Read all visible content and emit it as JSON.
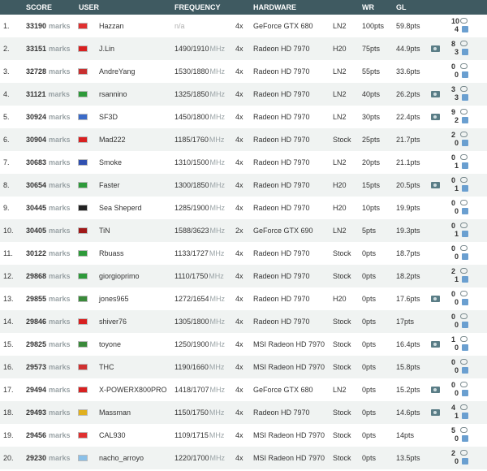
{
  "headers": {
    "score": "SCORE",
    "user": "USER",
    "frequency": "FREQUENCY",
    "hardware": "HARDWARE",
    "wr": "WR",
    "gl": "GL"
  },
  "rows": [
    {
      "rank": "1.",
      "score": "33190",
      "unit": "marks",
      "flag": "#e03030",
      "user": "Hazzan",
      "freq": "n/a",
      "mhz": "",
      "cores": "4x",
      "hw": "GeForce GTX 680",
      "cool": "LN2",
      "wr": "100pts",
      "gl": "59.8pts",
      "cam": false,
      "c1": "10",
      "c2": "4"
    },
    {
      "rank": "2.",
      "score": "33151",
      "unit": "marks",
      "flag": "#d82020",
      "user": "J.Lin",
      "freq": "1490/1910",
      "mhz": "MHz",
      "cores": "4x",
      "hw": "Radeon HD 7970",
      "cool": "H20",
      "wr": "75pts",
      "gl": "44.9pts",
      "cam": true,
      "c1": "8",
      "c2": "3"
    },
    {
      "rank": "3.",
      "score": "32728",
      "unit": "marks",
      "flag": "#c83030",
      "user": "AndreYang",
      "freq": "1530/1880",
      "mhz": "MHz",
      "cores": "4x",
      "hw": "Radeon HD 7970",
      "cool": "LN2",
      "wr": "55pts",
      "gl": "33.6pts",
      "cam": false,
      "c1": "0",
      "c2": "0"
    },
    {
      "rank": "4.",
      "score": "31121",
      "unit": "marks",
      "flag": "#2e9a3a",
      "user": "rsannino",
      "freq": "1325/1850",
      "mhz": "MHz",
      "cores": "4x",
      "hw": "Radeon HD 7970",
      "cool": "LN2",
      "wr": "40pts",
      "gl": "26.2pts",
      "cam": true,
      "c1": "3",
      "c2": "3"
    },
    {
      "rank": "5.",
      "score": "30924",
      "unit": "marks",
      "flag": "#3a6ac8",
      "user": "SF3D",
      "freq": "1450/1800",
      "mhz": "MHz",
      "cores": "4x",
      "hw": "Radeon HD 7970",
      "cool": "LN2",
      "wr": "30pts",
      "gl": "22.4pts",
      "cam": true,
      "c1": "9",
      "c2": "2"
    },
    {
      "rank": "6.",
      "score": "30904",
      "unit": "marks",
      "flag": "#d82020",
      "user": "Mad222",
      "freq": "1185/1760",
      "mhz": "MHz",
      "cores": "4x",
      "hw": "Radeon HD 7970",
      "cool": "Stock",
      "wr": "25pts",
      "gl": "21.7pts",
      "cam": false,
      "c1": "2",
      "c2": "0"
    },
    {
      "rank": "7.",
      "score": "30683",
      "unit": "marks",
      "flag": "#3050b0",
      "user": "Smoke",
      "freq": "1310/1500",
      "mhz": "MHz",
      "cores": "4x",
      "hw": "Radeon HD 7970",
      "cool": "LN2",
      "wr": "20pts",
      "gl": "21.1pts",
      "cam": false,
      "c1": "0",
      "c2": "1"
    },
    {
      "rank": "8.",
      "score": "30654",
      "unit": "marks",
      "flag": "#2e9a3a",
      "user": "Faster",
      "freq": "1300/1850",
      "mhz": "MHz",
      "cores": "4x",
      "hw": "Radeon HD 7970",
      "cool": "H20",
      "wr": "15pts",
      "gl": "20.5pts",
      "cam": true,
      "c1": "0",
      "c2": "1"
    },
    {
      "rank": "9.",
      "score": "30445",
      "unit": "marks",
      "flag": "#222222",
      "user": "Sea Sheperd",
      "freq": "1285/1900",
      "mhz": "MHz",
      "cores": "4x",
      "hw": "Radeon HD 7970",
      "cool": "H20",
      "wr": "10pts",
      "gl": "19.9pts",
      "cam": false,
      "c1": "0",
      "c2": "0"
    },
    {
      "rank": "10.",
      "score": "30405",
      "unit": "marks",
      "flag": "#a01818",
      "user": "TiN",
      "freq": "1588/3623",
      "mhz": "MHz",
      "cores": "2x",
      "hw": "GeForce GTX 690",
      "cool": "LN2",
      "wr": "5pts",
      "gl": "19.3pts",
      "cam": false,
      "c1": "0",
      "c2": "1"
    },
    {
      "rank": "11.",
      "score": "30122",
      "unit": "marks",
      "flag": "#2e9a3a",
      "user": "Rbuass",
      "freq": "1133/1727",
      "mhz": "MHz",
      "cores": "4x",
      "hw": "Radeon HD 7970",
      "cool": "Stock",
      "wr": "0pts",
      "gl": "18.7pts",
      "cam": false,
      "c1": "0",
      "c2": "0"
    },
    {
      "rank": "12.",
      "score": "29868",
      "unit": "marks",
      "flag": "#2e9a3a",
      "user": "giorgioprimo",
      "freq": "1110/1750",
      "mhz": "MHz",
      "cores": "4x",
      "hw": "Radeon HD 7970",
      "cool": "Stock",
      "wr": "0pts",
      "gl": "18.2pts",
      "cam": false,
      "c1": "2",
      "c2": "1"
    },
    {
      "rank": "13.",
      "score": "29855",
      "unit": "marks",
      "flag": "#3a8a3a",
      "user": "jones965",
      "freq": "1272/1654",
      "mhz": "MHz",
      "cores": "4x",
      "hw": "Radeon HD 7970",
      "cool": "H20",
      "wr": "0pts",
      "gl": "17.6pts",
      "cam": true,
      "c1": "0",
      "c2": "0"
    },
    {
      "rank": "14.",
      "score": "29846",
      "unit": "marks",
      "flag": "#d82020",
      "user": "shiver76",
      "freq": "1305/1800",
      "mhz": "MHz",
      "cores": "4x",
      "hw": "Radeon HD 7970",
      "cool": "Stock",
      "wr": "0pts",
      "gl": "17pts",
      "cam": false,
      "c1": "0",
      "c2": "0"
    },
    {
      "rank": "15.",
      "score": "29825",
      "unit": "marks",
      "flag": "#3a8a3a",
      "user": "toyone",
      "freq": "1250/1900",
      "mhz": "MHz",
      "cores": "4x",
      "hw": "MSI Radeon HD 7970",
      "cool": "Stock",
      "wr": "0pts",
      "gl": "16.4pts",
      "cam": true,
      "c1": "1",
      "c2": "0"
    },
    {
      "rank": "16.",
      "score": "29573",
      "unit": "marks",
      "flag": "#d03030",
      "user": "THC",
      "freq": "1190/1660",
      "mhz": "MHz",
      "cores": "4x",
      "hw": "MSI Radeon HD 7970",
      "cool": "Stock",
      "wr": "0pts",
      "gl": "15.8pts",
      "cam": false,
      "c1": "0",
      "c2": "0"
    },
    {
      "rank": "17.",
      "score": "29494",
      "unit": "marks",
      "flag": "#d82020",
      "user": "X-POWERX800PRO",
      "freq": "1418/1707",
      "mhz": "MHz",
      "cores": "4x",
      "hw": "GeForce GTX 680",
      "cool": "LN2",
      "wr": "0pts",
      "gl": "15.2pts",
      "cam": true,
      "c1": "0",
      "c2": "0"
    },
    {
      "rank": "18.",
      "score": "29493",
      "unit": "marks",
      "flag": "#e0b020",
      "user": "Massman",
      "freq": "1150/1750",
      "mhz": "MHz",
      "cores": "4x",
      "hw": "Radeon HD 7970",
      "cool": "Stock",
      "wr": "0pts",
      "gl": "14.6pts",
      "cam": true,
      "c1": "4",
      "c2": "1"
    },
    {
      "rank": "19.",
      "score": "29456",
      "unit": "marks",
      "flag": "#e03030",
      "user": "CAL930",
      "freq": "1109/1715",
      "mhz": "MHz",
      "cores": "4x",
      "hw": "MSI Radeon HD 7970",
      "cool": "Stock",
      "wr": "0pts",
      "gl": "14pts",
      "cam": false,
      "c1": "5",
      "c2": "0"
    },
    {
      "rank": "20.",
      "score": "29230",
      "unit": "marks",
      "flag": "#8ac0e8",
      "user": "nacho_arroyo",
      "freq": "1220/1700",
      "mhz": "MHz",
      "cores": "4x",
      "hw": "MSI Radeon HD 7970",
      "cool": "Stock",
      "wr": "0pts",
      "gl": "13.5pts",
      "cam": false,
      "c1": "2",
      "c2": "0"
    }
  ]
}
